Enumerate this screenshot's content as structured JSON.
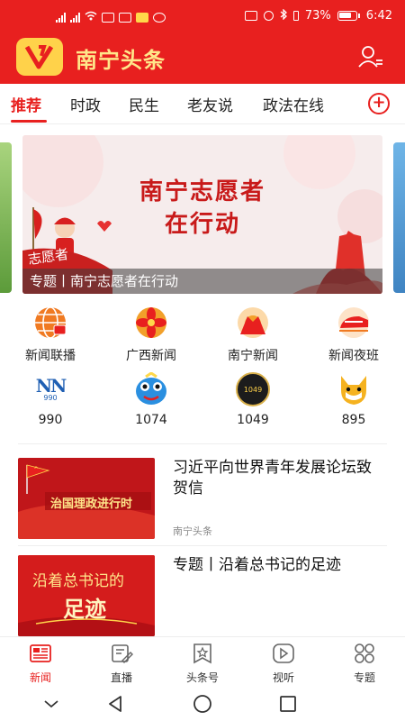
{
  "status_bar": {
    "battery": "73%",
    "time": "6:42"
  },
  "header": {
    "app_title": "南宁头条"
  },
  "tabs": [
    {
      "label": "推荐",
      "active": true
    },
    {
      "label": "时政",
      "active": false
    },
    {
      "label": "民生",
      "active": false
    },
    {
      "label": "老友说",
      "active": false
    },
    {
      "label": "政法在线",
      "active": false
    }
  ],
  "banner": {
    "title_line1": "南宁志愿者",
    "title_line2": "在行动",
    "caption": "专题丨南宁志愿者在行动",
    "badge_text": "志愿者"
  },
  "quick_entries_row1": [
    {
      "label": "新闻联播",
      "icon": "tv-globe-icon"
    },
    {
      "label": "广西新闻",
      "icon": "flower-emblem-icon"
    },
    {
      "label": "南宁新闻",
      "icon": "sunrise-icon"
    },
    {
      "label": "新闻夜班",
      "icon": "train-icon"
    }
  ],
  "quick_entries_row2": [
    {
      "label": "990",
      "icon": "nn990-radio-logo",
      "logo_text": "NN",
      "logo_sub": "990"
    },
    {
      "label": "1074",
      "icon": "blue-mascot-icon"
    },
    {
      "label": "1049",
      "icon": "record-1049-icon",
      "logo_text": "1049"
    },
    {
      "label": "895",
      "icon": "fox-mascot-icon"
    }
  ],
  "news": [
    {
      "title": "习近平向世界青年发展论坛致贺信",
      "source": "南宁头条",
      "thumb_text": "治国理政进行时"
    },
    {
      "title": "专题丨沿着总书记的足迹",
      "source": "",
      "thumb_line1": "沿着总书记的",
      "thumb_line2": "足迹"
    }
  ],
  "bottom_nav": [
    {
      "label": "新闻",
      "icon": "newspaper-icon",
      "active": true
    },
    {
      "label": "直播",
      "icon": "live-edit-icon",
      "active": false
    },
    {
      "label": "头条号",
      "icon": "star-bookmark-icon",
      "active": false
    },
    {
      "label": "视听",
      "icon": "play-icon",
      "active": false
    },
    {
      "label": "专题",
      "icon": "grid-icon",
      "active": false
    }
  ],
  "colors": {
    "brand_red": "#e8201f",
    "title_yellow": "#ffe68a",
    "logo_yellow": "#ffd24a"
  }
}
